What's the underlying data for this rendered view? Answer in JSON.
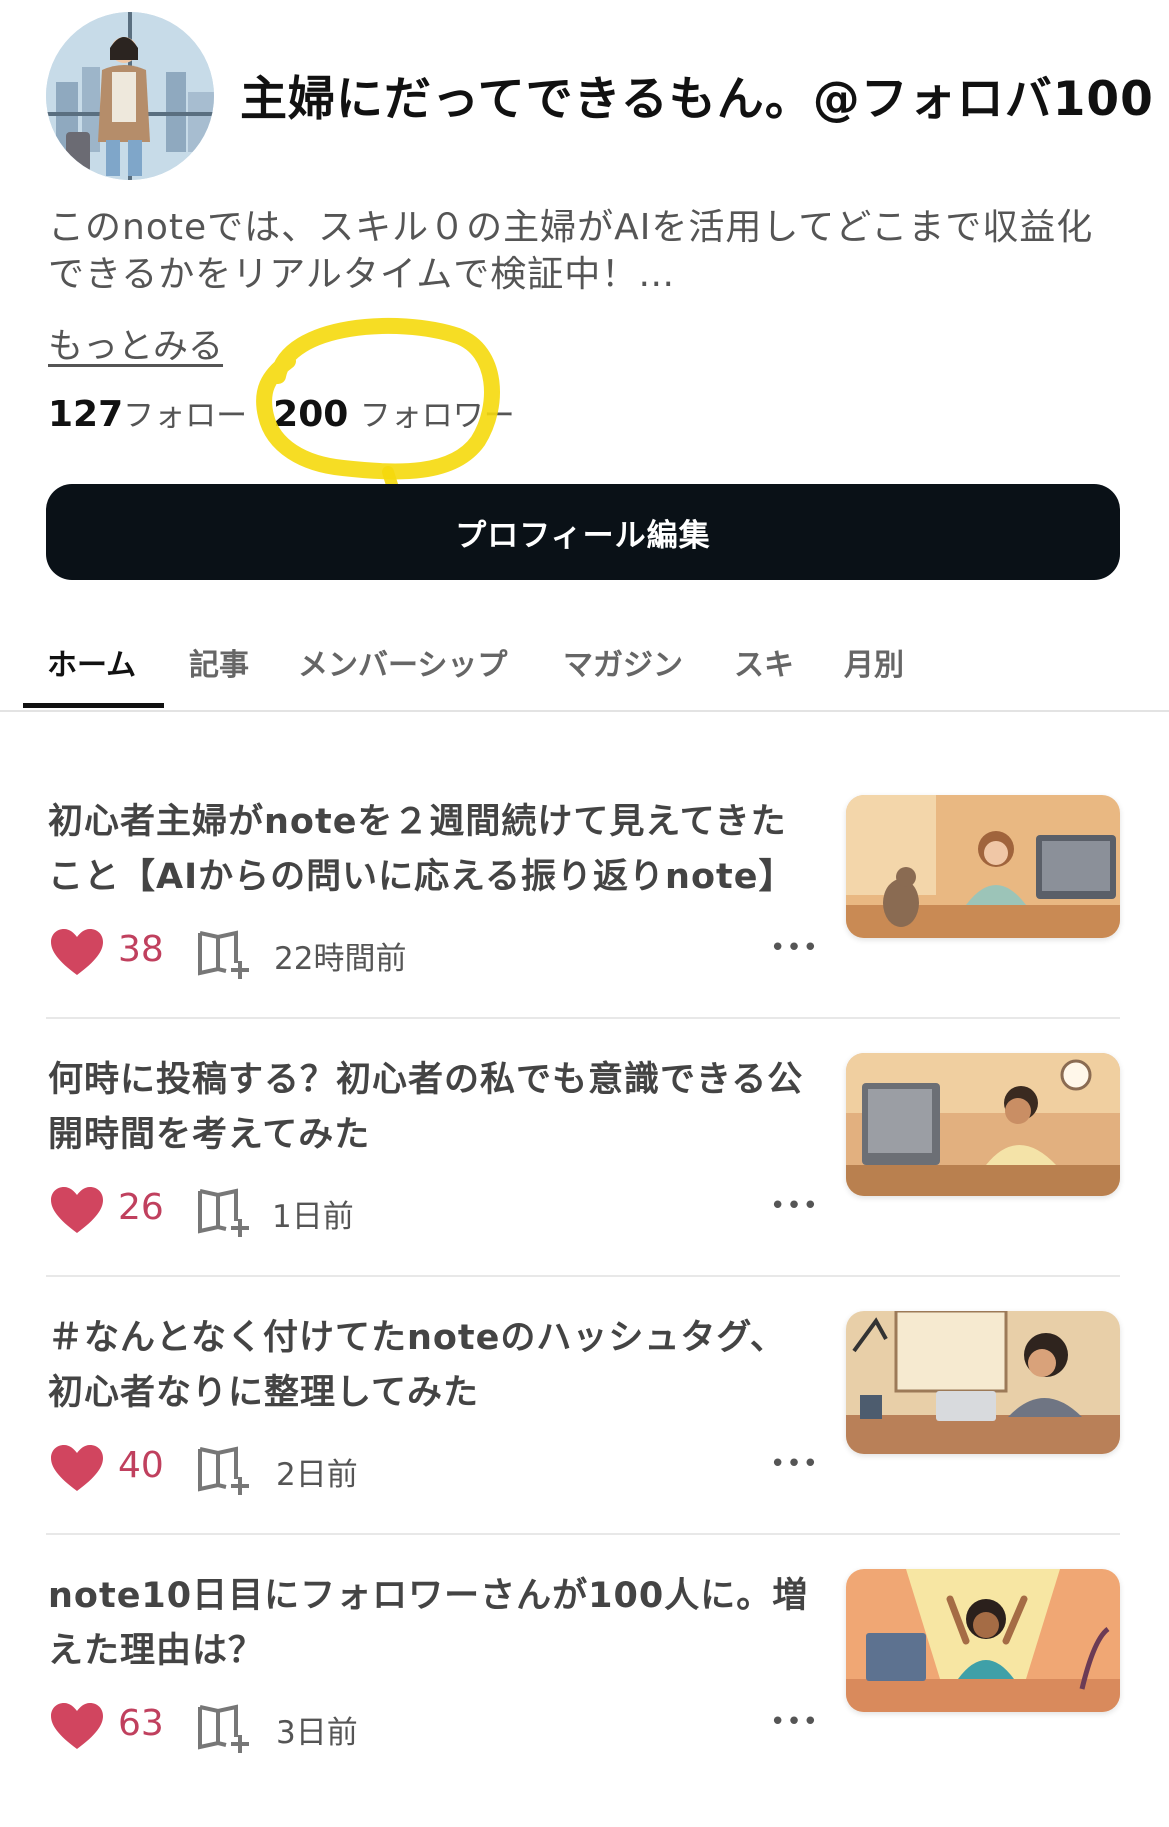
{
  "profile": {
    "name": "主婦にだってできるもん。@フォロバ100",
    "bio": "このnoteでは、スキル０の主婦がAIを活用してどこまで収益化できるかをリアルタイムで検証中！…",
    "more_link": "もっとみる",
    "following_count": "127",
    "following_label": "フォロー",
    "followers_count": "200",
    "followers_label": "フォロワー",
    "edit_button": "プロフィール編集"
  },
  "tabs": [
    {
      "label": "ホーム",
      "active": true
    },
    {
      "label": "記事"
    },
    {
      "label": "メンバーシップ"
    },
    {
      "label": "マガジン"
    },
    {
      "label": "スキ"
    },
    {
      "label": "月別"
    }
  ],
  "articles": [
    {
      "title": "初心者主婦がnoteを２週間続けて見えてきたこと【AIからの問いに応える振り返りnote】",
      "likes": "38",
      "time": "22時間前",
      "more": "•••"
    },
    {
      "title": "何時に投稿する？初心者の私でも意識できる公開時間を考えてみた",
      "likes": "26",
      "time": "1日前",
      "more": "•••"
    },
    {
      "title": "＃なんとなく付けてたnoteのハッシュタグ、初心者なりに整理してみた",
      "likes": "40",
      "time": "2日前",
      "more": "•••"
    },
    {
      "title": "note10日目にフォロワーさんが100人に。増えた理由は？",
      "likes": "63",
      "time": "3日前",
      "more": "•••"
    }
  ],
  "colors": {
    "heart": "#d1455f",
    "button_bg": "#0a1117",
    "highlight": "#f5d90c",
    "tab_active": "#111111"
  }
}
